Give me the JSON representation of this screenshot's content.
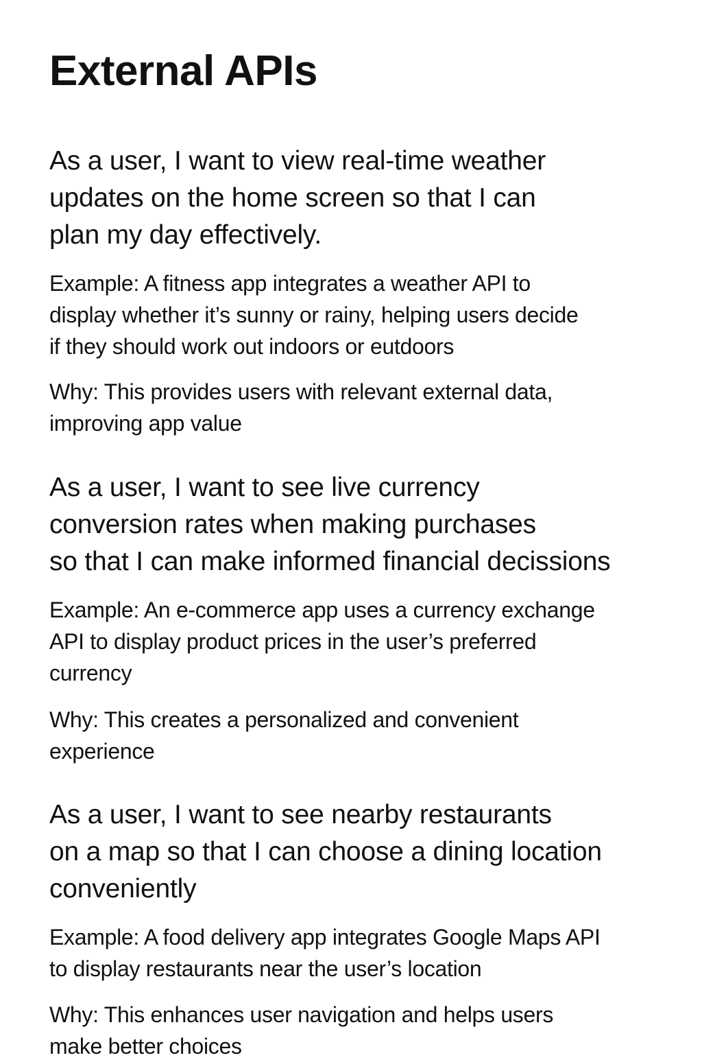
{
  "page": {
    "title": "External APIs"
  },
  "stories": [
    {
      "story_lines": [
        "As a user, I want to view real-time weather",
        "updates on the home screen so that I can",
        "plan my day effectively."
      ],
      "example_lines": [
        "Example: A fitness app integrates a weather API to",
        "display whether it’s sunny or rainy, helping users decide",
        "if they should work out indoors or eutdoors"
      ],
      "why_lines": [
        "Why: This provides users with relevant external data,",
        "improving app value"
      ]
    },
    {
      "story_lines": [
        "As a user, I want to see live currency",
        "conversion rates when making purchases",
        "so that I can make informed financial decissions"
      ],
      "example_lines": [
        "Example: An e-commerce app uses a currency exchange",
        "API to display product prices in the user’s preferred",
        "currency"
      ],
      "why_lines": [
        "Why: This creates a personalized and convenient",
        "experience"
      ]
    },
    {
      "story_lines": [
        "As a user, I want to see nearby restaurants",
        "on a map so that I can choose a dining location",
        "conveniently"
      ],
      "example_lines": [
        "Example: A food delivery app integrates Google Maps API",
        "to display restaurants near the user’s location"
      ],
      "why_lines": [
        "Why: This enhances user navigation and helps users",
        "make better choices"
      ]
    }
  ]
}
